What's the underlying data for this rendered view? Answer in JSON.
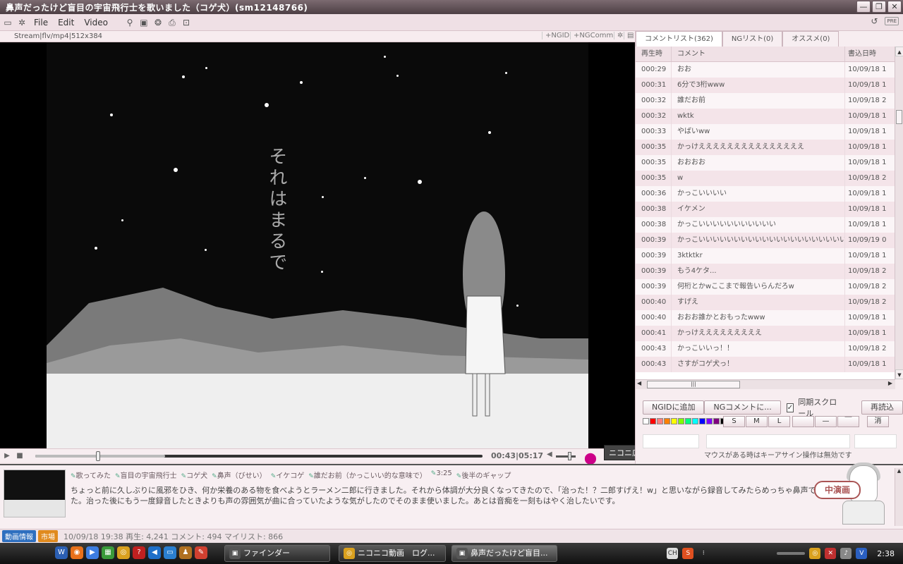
{
  "window": {
    "title": "鼻声だったけど盲目の宇宙飛行士を歌いました（コゲ犬）(sm12148766)",
    "btn_min": "—",
    "btn_max": "❐",
    "btn_close": "✕"
  },
  "menu": {
    "file": "File",
    "edit": "Edit",
    "video": "Video",
    "pre": "PRE"
  },
  "subbar": {
    "stream": "Stream|flv/mp4|512x384",
    "ngid": "+NGID",
    "ngcomm": "+NGComm"
  },
  "video": {
    "vertical_text": "それはまるで"
  },
  "controls": {
    "time": "00:43|05:17",
    "progress": 0.136,
    "buffered": 0.29,
    "volume": 0.7,
    "tooltip": "ニコニ広告提供のON/OFF"
  },
  "panel": {
    "tabs": [
      "コメントリスト(362)",
      "NGリスト(0)",
      "オススメ(0)"
    ],
    "headers": {
      "time": "再生時",
      "comment": "コメント",
      "date": "書込日時"
    },
    "rows": [
      {
        "t": "000:29",
        "c": "おお",
        "d": "10/09/18 1"
      },
      {
        "t": "000:31",
        "c": "6分で3桁www",
        "d": "10/09/18 1"
      },
      {
        "t": "000:32",
        "c": "誰だお前",
        "d": "10/09/18 2"
      },
      {
        "t": "000:32",
        "c": "wktk",
        "d": "10/09/18 1"
      },
      {
        "t": "000:33",
        "c": "やばいww",
        "d": "10/09/18 1"
      },
      {
        "t": "000:35",
        "c": "かっけえええええええええええええええ",
        "d": "10/09/18 1"
      },
      {
        "t": "000:35",
        "c": "おおおお",
        "d": "10/09/18 1"
      },
      {
        "t": "000:35",
        "c": "w",
        "d": "10/09/18 2"
      },
      {
        "t": "000:36",
        "c": "かっこいいいい",
        "d": "10/09/18 1"
      },
      {
        "t": "000:38",
        "c": "イケメン",
        "d": "10/09/18 1"
      },
      {
        "t": "000:38",
        "c": "かっこいいいいいいいいいいい",
        "d": "10/09/18 1"
      },
      {
        "t": "000:39",
        "c": "かっこいいいいいいいいいいいいいいいいいいいいい",
        "d": "10/09/19 0"
      },
      {
        "t": "000:39",
        "c": "3ktktkr",
        "d": "10/09/18 1"
      },
      {
        "t": "000:39",
        "c": "もう4ケタ...",
        "d": "10/09/18 2"
      },
      {
        "t": "000:39",
        "c": "何桁とかwここまで報告いらんだろw",
        "d": "10/09/18 2"
      },
      {
        "t": "000:40",
        "c": "すげえ",
        "d": "10/09/18 2"
      },
      {
        "t": "000:40",
        "c": "おおお誰かとおもったwww",
        "d": "10/09/18 1"
      },
      {
        "t": "000:41",
        "c": "かっけえええええええええ",
        "d": "10/09/18 1"
      },
      {
        "t": "000:43",
        "c": "かっこいいっ！！",
        "d": "10/09/18 2"
      },
      {
        "t": "000:43",
        "c": "さすがコゲ犬っ！",
        "d": "10/09/18 1"
      }
    ],
    "btn_ngid": "NGIDに追加",
    "btn_ngcomment": "NGコメントに...",
    "sync_scroll": "同期スクロール",
    "sync_check": "✓",
    "btn_reload": "再読込",
    "size_s": "S",
    "size_m": "M",
    "size_l": "L",
    "pos_1": "",
    "pos_2": "—",
    "pos_3": "￣",
    "btn_clear": "消",
    "colors": [
      "#ffffff",
      "#ff0000",
      "#ff8080",
      "#ff8000",
      "#ffff00",
      "#80ff00",
      "#00ff80",
      "#00ffff",
      "#0000ff",
      "#8000ff",
      "#800080",
      "#000000"
    ],
    "note": "マウスがある時はキーアサイン操作は無効です"
  },
  "desc": {
    "tags": [
      "歌ってみた",
      "盲目の宇宙飛行士",
      "コゲ犬",
      "鼻声（びせい）",
      "イケコゲ",
      "誰だお前（かっこいい的な意味で）",
      "3:25",
      "後半のギャップ"
    ],
    "text": "ちょっと前に久しぶりに風邪をひき、何か栄養のある物を食べようとラーメン二郎に行きました。それから体調が大分良くなってきたので、「治った！？二郎すげえ！w」と思いながら録音してみたらめっちゃ鼻声でした。治った後にもう一度録音したときよりも声の雰囲気が曲に合っていたような気がしたのでそのまま使いました。あとは音痴を一刻もはやく治したいです。",
    "stamp": "中演画"
  },
  "status": {
    "badge_info": "動画情報",
    "badge_market": "市場",
    "stats": "10/09/18 19:38 再生: 4,241 コメント: 494 マイリスト: 866"
  },
  "taskbar": {
    "tasks": [
      "ファインダー",
      "ニコニコ動画　ログ...",
      "鼻声だったけど盲目..."
    ],
    "clock": "2:38",
    "tray_ch": "CH"
  }
}
